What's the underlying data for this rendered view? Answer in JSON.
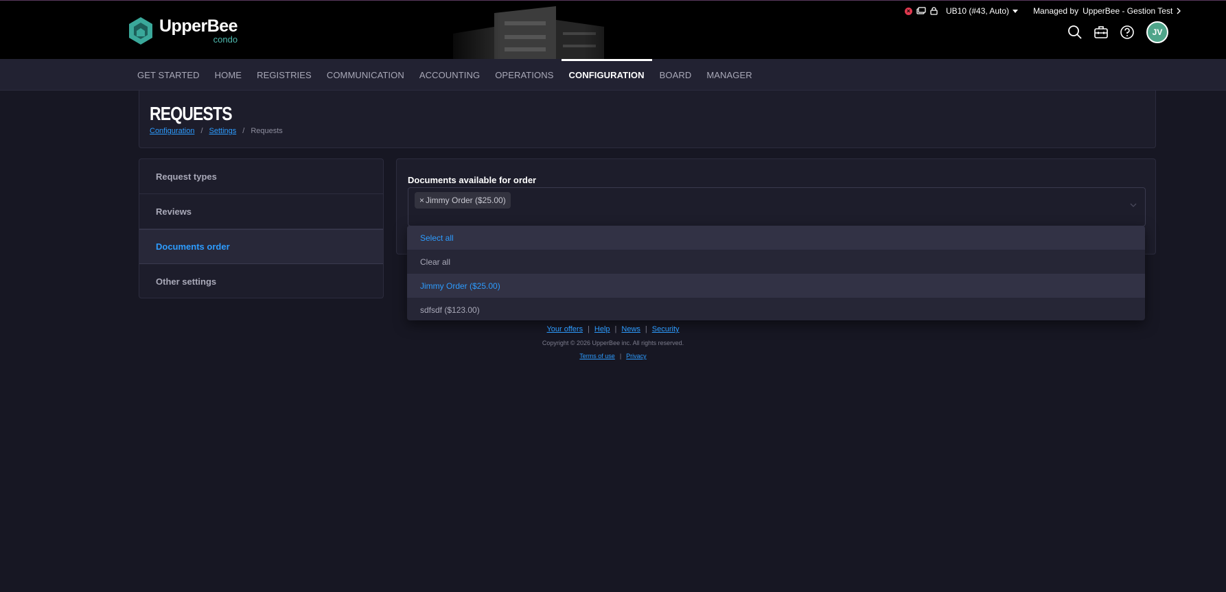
{
  "brand": {
    "name": "UpperBee",
    "sub": "condo"
  },
  "top_status": {
    "unit": "UB10 (#43, Auto)",
    "managed_label": "Managed by",
    "managed_org": "UpperBee - Gestion Test"
  },
  "user": {
    "initials": "JV"
  },
  "nav": {
    "items": [
      "Get started",
      "Home",
      "Registries",
      "Communication",
      "Accounting",
      "Operations",
      "Configuration",
      "Board",
      "Manager"
    ],
    "active": "Configuration"
  },
  "page": {
    "title": "REQUESTS",
    "breadcrumb": [
      "Configuration",
      "Settings",
      "Requests"
    ]
  },
  "side_menu": {
    "items": [
      "Request types",
      "Reviews",
      "Documents order",
      "Other settings"
    ],
    "active": "Documents order"
  },
  "form": {
    "label": "Documents available for order",
    "selected": [
      "Jimmy Order ($25.00)"
    ]
  },
  "dropdown": {
    "options": [
      "Select all",
      "Clear all",
      "Jimmy Order ($25.00)",
      "sdfsdf ($123.00)"
    ]
  },
  "footer": {
    "links": [
      "Your offers",
      "Help",
      "News",
      "Security"
    ],
    "copyright": "Copyright © 2026 UpperBee inc. All rights reserved.",
    "legal": [
      "Terms of use",
      "Privacy"
    ]
  },
  "colors": {
    "accent": "#2d9cff",
    "brand_teal": "#4fb9ae",
    "bg": "#171723",
    "panel": "#1d1d2b",
    "avatar": "#4fa58a",
    "status_red": "#e0394f"
  }
}
